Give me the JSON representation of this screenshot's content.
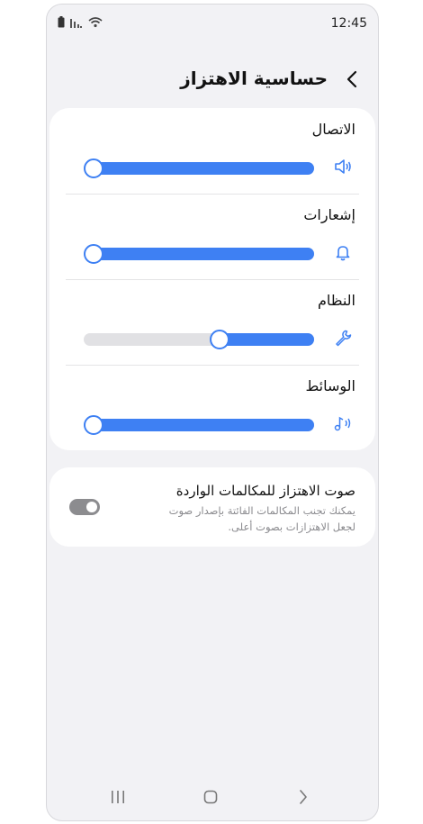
{
  "status_bar": {
    "time": "12:45"
  },
  "header": {
    "title": "حساسية الاهتزاز"
  },
  "sliders": [
    {
      "label": "الاتصال",
      "icon": "speaker-icon",
      "level": 0
    },
    {
      "label": "إشعارات",
      "icon": "bell-icon",
      "level": 0
    },
    {
      "label": "النظام",
      "icon": "wrench-icon",
      "level": 0.6
    },
    {
      "label": "الوسائط",
      "icon": "music-note-icon",
      "level": 0
    }
  ],
  "incoming_call_setting": {
    "title": "صوت الاهتزاز للمكالمات الواردة",
    "description": "يمكنك تجنب المكالمات الفائتة بإصدار صوت لجعل الاهتزازات بصوت أعلى.",
    "enabled": false
  },
  "colors": {
    "accent": "#3e80f3",
    "track": "#e1e1e4",
    "toggle_off": "#8c8c8f"
  }
}
